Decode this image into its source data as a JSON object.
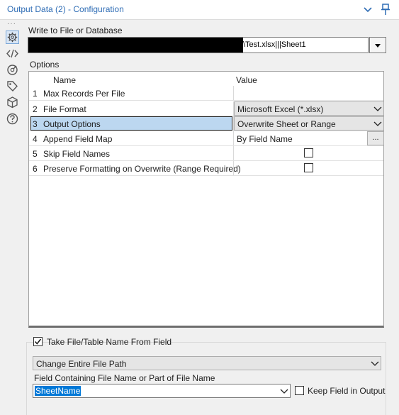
{
  "window": {
    "title": "Output Data (2) - Configuration"
  },
  "write_section": {
    "label": "Write to File or Database",
    "path_value": "\\Test.xlsx|||Sheet1"
  },
  "options": {
    "label": "Options",
    "col_name": "Name",
    "col_value": "Value",
    "rows": [
      {
        "num": "1",
        "name": "Max Records Per File",
        "value": ""
      },
      {
        "num": "2",
        "name": "File Format",
        "value": "Microsoft Excel (*.xlsx)"
      },
      {
        "num": "3",
        "name": "Output Options",
        "value": "Overwrite Sheet or Range"
      },
      {
        "num": "4",
        "name": "Append Field Map",
        "value": "By Field Name",
        "button": "..."
      },
      {
        "num": "5",
        "name": "Skip Field Names",
        "value": "",
        "checked": false
      },
      {
        "num": "6",
        "name": "Preserve Formatting on Overwrite (Range Required)",
        "value": "",
        "checked": false
      }
    ]
  },
  "take_from_field": {
    "label": "Take File/Table Name From Field",
    "checked": true,
    "mode_value": "Change Entire File Path",
    "field_label": "Field Containing File Name or Part of File Name",
    "field_value": "SheetName",
    "keep_label": "Keep Field in Output",
    "keep_checked": false
  },
  "colors": {
    "title": "#2f6db5",
    "selection": "#bcd7f0",
    "text_selection": "#0078d7"
  },
  "icons": [
    "gear-icon",
    "code-icon",
    "connection-icon",
    "tag-icon",
    "cube-icon",
    "help-icon",
    "chevron-down-icon",
    "pin-icon",
    "check-icon"
  ]
}
